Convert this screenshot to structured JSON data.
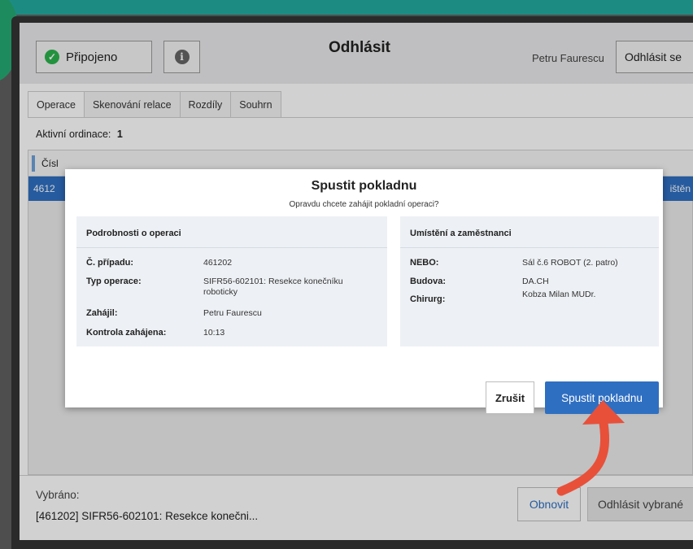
{
  "header": {
    "status_label": "Připojeno",
    "title": "Odhlásit",
    "user_name": "Petru Faurescu",
    "logout_label": "Odhlásit se"
  },
  "tabs": [
    {
      "label": "Operace",
      "active": true
    },
    {
      "label": "Skenování relace",
      "active": false
    },
    {
      "label": "Rozdíly",
      "active": false
    },
    {
      "label": "Souhrn",
      "active": false
    }
  ],
  "active_rooms": {
    "label": "Aktivní ordinace:",
    "value": "1"
  },
  "list": {
    "header_partial": "Čísl",
    "row_partial_left": "4612",
    "row_partial_right": "ištěn"
  },
  "modal": {
    "title": "Spustit pokladnu",
    "subtitle": "Opravdu chcete zahájit pokladní operaci?",
    "left_panel": {
      "title": "Podrobnosti o operaci",
      "rows": [
        {
          "key": "Č. případu:",
          "value": "461202"
        },
        {
          "key": "Typ operace:",
          "value": "SIFR56-602101: Resekce konečníku roboticky"
        },
        {
          "key": "Zahájil:",
          "value": "Petru Faurescu"
        },
        {
          "key": "Kontrola zahájena:",
          "value": "10:13"
        }
      ]
    },
    "right_panel": {
      "title": "Umístění a zaměstnanci",
      "rows": [
        {
          "key": "NEBO:",
          "value": "Sál č.6 ROBOT (2. patro)"
        },
        {
          "key": "Budova:",
          "value": "DA.CH"
        },
        {
          "key": "Chirurg:",
          "value": "Kobza Milan MUDr."
        }
      ]
    },
    "cancel_label": "Zrušit",
    "start_label": "Spustit pokladnu"
  },
  "bottom": {
    "selected_label": "Vybráno:",
    "selected_value": "[461202] SIFR56-602101: Resekce konečni...",
    "refresh_label": "Obnovit",
    "logout_selected_label": "Odhlásit vybrané"
  },
  "colors": {
    "accent_blue": "#2f6fc2",
    "status_green": "#2bb24c",
    "arrow_red": "#e8503a",
    "frame_teal": "#1c8c83"
  },
  "icons": [
    "check-circle-icon",
    "info-icon",
    "curved-arrow-icon"
  ]
}
